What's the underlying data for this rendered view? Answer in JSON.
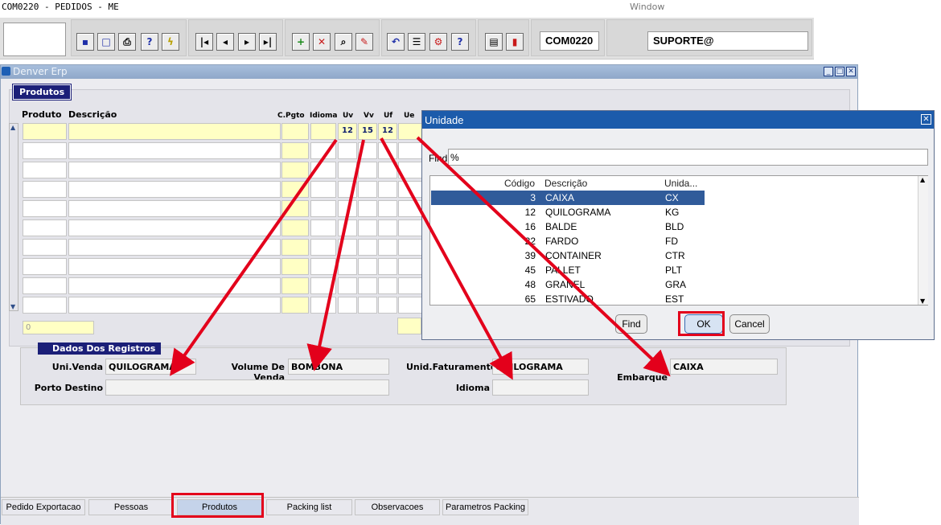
{
  "titlebar": {
    "app_title": "COM0220 - PEDIDOS - ME",
    "window_menu": "Window"
  },
  "toolbar": {
    "module_code": "COM0220",
    "user": "SUPORTE@",
    "icons": [
      "save-icon",
      "clear-icon",
      "print-icon",
      "help-query-icon",
      "flash-icon",
      "first-record-icon",
      "previous-record-icon",
      "next-record-icon",
      "last-record-icon",
      "insert-record-icon",
      "delete-record-icon",
      "query-icon",
      "edit-icon",
      "undo-icon",
      "list-values-icon",
      "tools-icon",
      "help-icon",
      "menu-icon",
      "exit-icon"
    ]
  },
  "main_window": {
    "title": "Denver Erp",
    "block_tab": "Produtos",
    "columns": {
      "produto": "Produto",
      "descricao": "Descrição",
      "cpgto": "C.Pgto",
      "idioma": "Idioma",
      "uv": "Uv",
      "vv": "Vv",
      "uf": "Uf",
      "ue": "Ue"
    },
    "first_row": {
      "uv": "12",
      "vv": "15",
      "uf": "12"
    },
    "total_field": "0"
  },
  "dados": {
    "title": "Dados Dos Registros",
    "uni_venda_label": "Uni.Venda",
    "uni_venda_value": "QUILOGRAMA",
    "volume_venda_label": "Volume De Venda",
    "volume_venda_value": "BOMBONA",
    "unid_faturamento_label": "Unid.Faturamento",
    "unid_faturamento_value": "QUILOGRAMA",
    "uni_embarque_label": "Uni. Embarque",
    "uni_embarque_value": "CAIXA",
    "porto_destino_label": "Porto Destino",
    "idioma_label": "Idioma"
  },
  "bottom_tabs": [
    "Pedido Exportacao",
    "Pessoas",
    "Produtos",
    "Packing list",
    "Observacoes",
    "Parametros Packing"
  ],
  "dialog": {
    "title": "Unidade",
    "find_label": "Find",
    "find_value": "%",
    "headers": {
      "codigo": "Código",
      "descricao": "Descrição",
      "unidade": "Unida..."
    },
    "rows": [
      {
        "codigo": "3",
        "descricao": "CAIXA",
        "unidade": "CX"
      },
      {
        "codigo": "12",
        "descricao": "QUILOGRAMA",
        "unidade": "KG"
      },
      {
        "codigo": "16",
        "descricao": "BALDE",
        "unidade": "BLD"
      },
      {
        "codigo": "22",
        "descricao": "FARDO",
        "unidade": "FD"
      },
      {
        "codigo": "39",
        "descricao": "CONTAINER",
        "unidade": "CTR"
      },
      {
        "codigo": "45",
        "descricao": "PALLET",
        "unidade": "PLT"
      },
      {
        "codigo": "48",
        "descricao": "GRANEL",
        "unidade": "GRA"
      },
      {
        "codigo": "65",
        "descricao": "ESTIVADO",
        "unidade": "EST"
      }
    ],
    "selected_row": 0,
    "find_button": "Find",
    "ok_button": "OK",
    "cancel_button": "Cancel"
  },
  "colors": {
    "highlight": "#e3001b",
    "selected_row": "#305b9a",
    "tab_dark": "#1b1f78",
    "dialog_title": "#1c5bab"
  }
}
